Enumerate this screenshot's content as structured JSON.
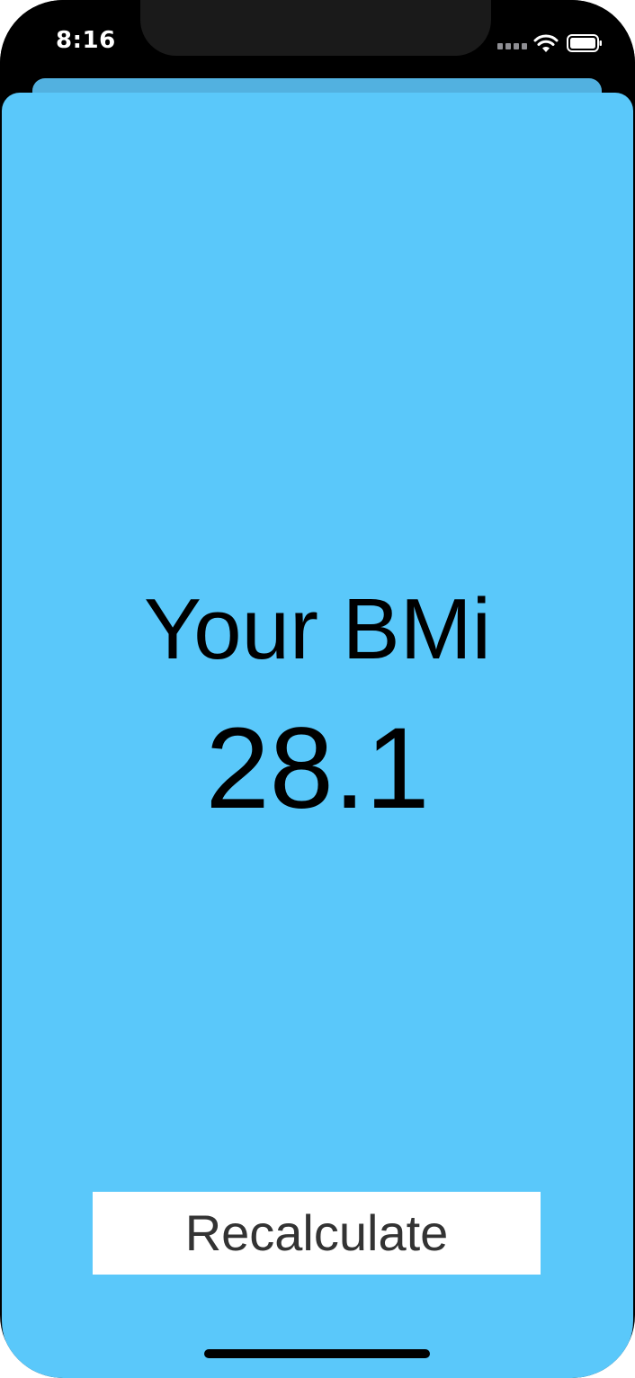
{
  "status_bar": {
    "time": "8:16",
    "icons": [
      "cellular-signal-icon",
      "wifi-icon",
      "battery-icon"
    ]
  },
  "result": {
    "title": "Your BMi",
    "value": "28.1"
  },
  "actions": {
    "recalculate_label": "Recalculate"
  },
  "colors": {
    "background": "#5ac8fa",
    "button": "#ffffff",
    "text": "#000000"
  }
}
